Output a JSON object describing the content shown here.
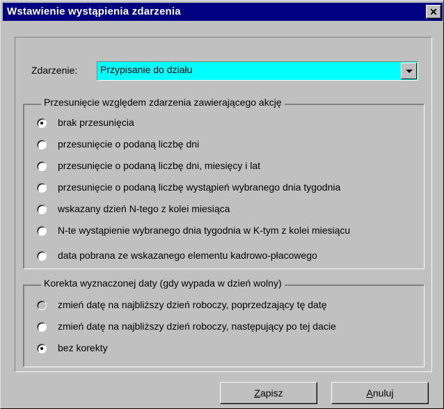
{
  "window": {
    "title": "Wstawienie wystąpienia zdarzenia",
    "close_glyph": "✕"
  },
  "event_field": {
    "label": "Zdarzenie:",
    "value": "Przypisanie do działu",
    "highlight_color": "#00ffff"
  },
  "offset_group": {
    "legend": "Przesunięcie względem zdarzenia zawierającego akcję",
    "options": [
      {
        "label": "brak przesunięcia",
        "selected": true
      },
      {
        "label": "przesunięcie o podaną liczbę dni",
        "selected": false
      },
      {
        "label": "przesunięcie o podaną liczbę dni, miesięcy i lat",
        "selected": false
      },
      {
        "label": "przesunięcie o podaną liczbę wystąpień wybranego dnia tygodnia",
        "selected": false
      },
      {
        "label": "wskazany dzień N-tego z kolei miesiąca",
        "selected": false
      },
      {
        "label": "N-te wystąpienie wybranego dnia tygodnia w K-tym z kolei miesiącu",
        "selected": false
      },
      {
        "label": "data pobrana ze wskazanego elementu kadrowo-płacowego",
        "selected": false
      }
    ]
  },
  "correction_group": {
    "legend": "Korekta wyznaczonej daty (gdy wypada w dzień wolny)",
    "options": [
      {
        "label": "zmień datę na najbliższy dzień roboczy, poprzedzający tę datę",
        "selected": false,
        "dimmed": true
      },
      {
        "label": "zmień datę na najbliższy dzień roboczy, następujący po tej dacie",
        "selected": false
      },
      {
        "label": "bez korekty",
        "selected": true
      }
    ]
  },
  "buttons": {
    "save": {
      "accel": "Z",
      "rest": "apisz"
    },
    "cancel": {
      "accel": "A",
      "rest": "nuluj"
    }
  }
}
